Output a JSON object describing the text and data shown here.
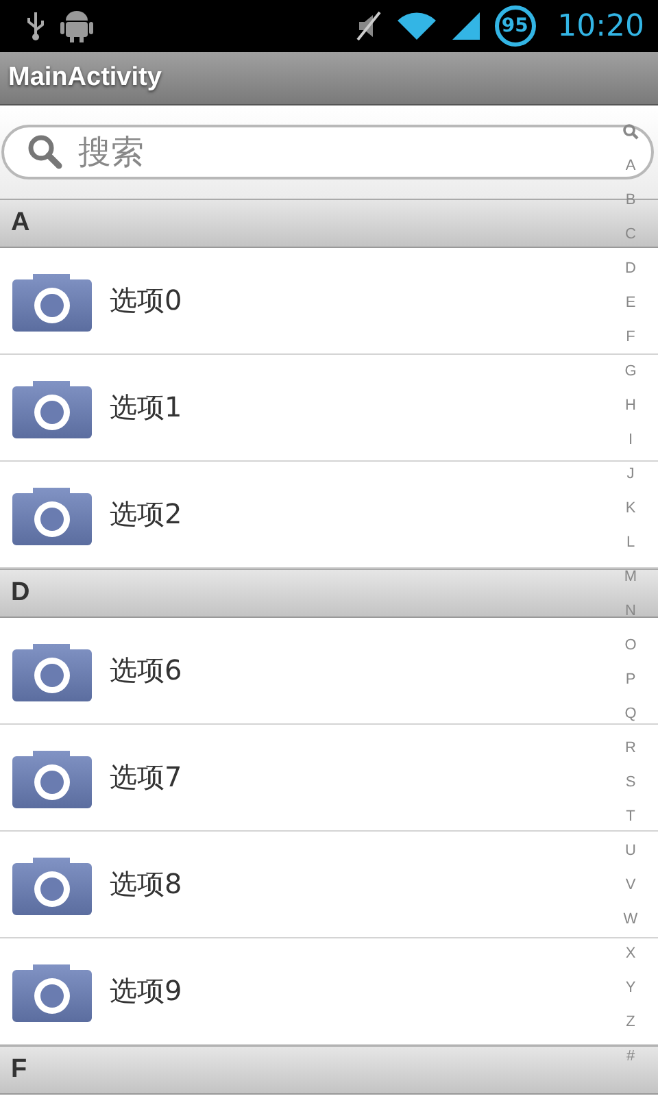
{
  "status_bar": {
    "battery": "95",
    "time": "10:20"
  },
  "title_bar": {
    "title": "MainActivity"
  },
  "search": {
    "placeholder": "搜索"
  },
  "sections": [
    {
      "letter": "A",
      "items": [
        {
          "label": "选项0"
        },
        {
          "label": "选项1"
        },
        {
          "label": "选项2"
        }
      ]
    },
    {
      "letter": "D",
      "items": [
        {
          "label": "选项6"
        },
        {
          "label": "选项7"
        },
        {
          "label": "选项8"
        },
        {
          "label": "选项9"
        }
      ]
    },
    {
      "letter": "F"
    }
  ],
  "index_bar": [
    "A",
    "B",
    "C",
    "D",
    "E",
    "F",
    "G",
    "H",
    "I",
    "J",
    "K",
    "L",
    "M",
    "N",
    "O",
    "P",
    "Q",
    "R",
    "S",
    "T",
    "U",
    "V",
    "W",
    "X",
    "Y",
    "Z",
    "#"
  ]
}
